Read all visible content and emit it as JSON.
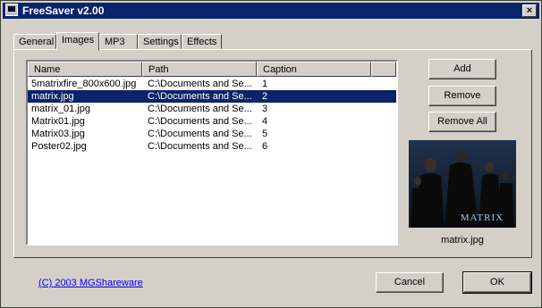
{
  "window": {
    "title": "FreeSaver v2.00",
    "close_glyph": "×"
  },
  "tabs": [
    {
      "label": "General",
      "active": false
    },
    {
      "label": "Images",
      "active": true
    },
    {
      "label": "MP3",
      "active": false
    },
    {
      "label": "Settings",
      "active": false
    },
    {
      "label": "Effects",
      "active": false
    }
  ],
  "list": {
    "columns": [
      "Name",
      "Path",
      "Caption"
    ],
    "rows": [
      {
        "name": "5matrixfire_800x600.jpg",
        "path": "C:\\Documents and Se...",
        "caption": "1",
        "selected": false
      },
      {
        "name": "matrix.jpg",
        "path": "C:\\Documents and Se...",
        "caption": "2",
        "selected": true
      },
      {
        "name": "matrix_01.jpg",
        "path": "C:\\Documents and Se...",
        "caption": "3",
        "selected": false
      },
      {
        "name": "Matrix01.jpg",
        "path": "C:\\Documents and Se...",
        "caption": "4",
        "selected": false
      },
      {
        "name": "Matrix03.jpg",
        "path": "C:\\Documents and Se...",
        "caption": "5",
        "selected": false
      },
      {
        "name": "Poster02.jpg",
        "path": "C:\\Documents and Se...",
        "caption": "6",
        "selected": false
      }
    ]
  },
  "side_buttons": {
    "add": "Add",
    "remove": "Remove",
    "remove_all": "Remove All"
  },
  "preview": {
    "caption": "matrix.jpg",
    "poster_text": "MATRIX"
  },
  "footer": {
    "copyright": "(C) 2003 MGShareware",
    "cancel": "Cancel",
    "ok": "OK"
  },
  "colors": {
    "titlebar": "#0a246a",
    "selection": "#0a246a",
    "face": "#d4d0c8"
  }
}
